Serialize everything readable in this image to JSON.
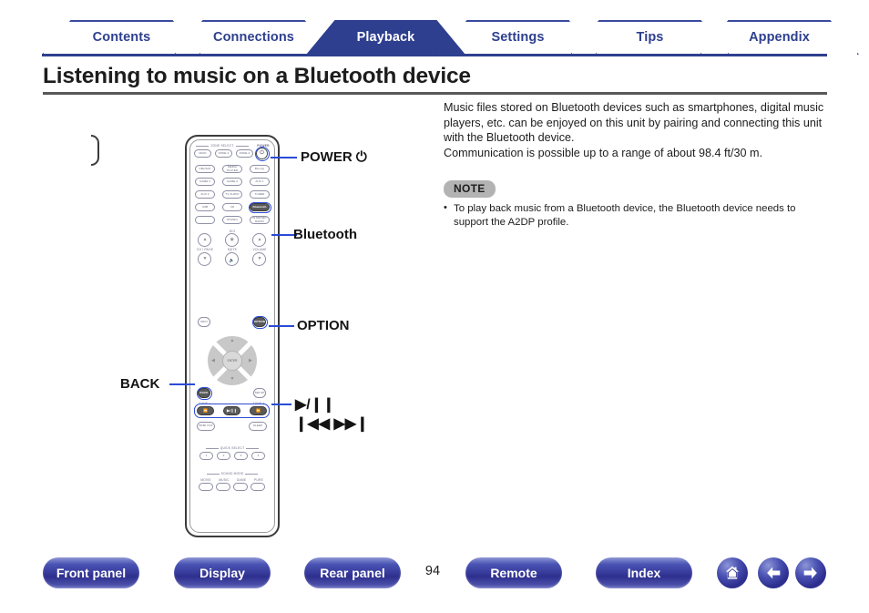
{
  "tabs": [
    {
      "label": "Contents",
      "active": false
    },
    {
      "label": "Connections",
      "active": false
    },
    {
      "label": "Playback",
      "active": true
    },
    {
      "label": "Settings",
      "active": false
    },
    {
      "label": "Tips",
      "active": false
    },
    {
      "label": "Appendix",
      "active": false
    }
  ],
  "page": {
    "title": "Listening to music on a Bluetooth device",
    "number": "94"
  },
  "intro": {
    "paragraph1": "Music files stored on Bluetooth devices such as smartphones, digital music players, etc. can be enjoyed on this unit by pairing and connecting this unit with the Bluetooth device.",
    "paragraph2": "Communication is possible up to a range of about 98.4 ft/30 m."
  },
  "note": {
    "badge": "NOTE",
    "items": [
      "To play back music from a Bluetooth device, the Bluetooth device needs to support the A2DP profile."
    ]
  },
  "callouts": {
    "power": "POWER ⏻",
    "bluetooth": "Bluetooth",
    "option": "OPTION",
    "back": "BACK",
    "playpause": "▶/❙❙",
    "skip": "❙◀◀  ▶▶❙"
  },
  "remote": {
    "zone_select_header": "ZONE SELECT",
    "power_header": "POWER",
    "quick_select_header": "QUICK SELECT",
    "sound_mode_header": "SOUND MODE",
    "dig_label": "DIG",
    "aux_label": "AUX",
    "ch_page_label": "CH / PAGE",
    "mute_label": "MUTE",
    "volume_label": "VOLUME",
    "tune_minus_label": "TUNE −",
    "tune_plus_label": "TUNE +",
    "zone_buttons": [
      "MAIN",
      "ZONE 2",
      "ZONE 3"
    ],
    "power_button": "⏻",
    "source_rows": [
      [
        "CBL/SAT",
        "MEDIA PLAYER",
        "Blu-ray"
      ],
      [
        "GAME 1",
        "GAME 2",
        "AUX 1"
      ],
      [
        "AUX 2",
        "TV AUDIO",
        "TUNER"
      ],
      [
        "USB",
        "CD",
        "Bluetooth"
      ],
      [
        "PHONO",
        "INTERNET RADIO"
      ]
    ],
    "info_button": "INFO",
    "option_button": "OPTION",
    "enter_button": "ENTER",
    "back_button": "BACK",
    "setup_button": "SETUP",
    "transport": [
      "⏪",
      "▶/❙❙",
      "⏩"
    ],
    "hdmi_out_button": "HDMI OUT",
    "sleep_button": "SLEEP",
    "quick_select_buttons": [
      "1",
      "2",
      "3",
      "4"
    ],
    "sound_mode_buttons": [
      "MOVIE",
      "MUSIC",
      "GAME",
      "PURE"
    ]
  },
  "footer": {
    "buttons": [
      {
        "label": "Front panel"
      },
      {
        "label": "Display"
      },
      {
        "label": "Rear panel"
      },
      {
        "label": "Remote"
      },
      {
        "label": "Index"
      }
    ],
    "icons": [
      {
        "name": "home-icon"
      },
      {
        "name": "arrow-left-icon"
      },
      {
        "name": "arrow-right-icon"
      }
    ]
  },
  "colors": {
    "brand_blue": "#2e3f8f",
    "leader_blue": "#2a4bd7",
    "note_grey": "#b3b3b3"
  }
}
